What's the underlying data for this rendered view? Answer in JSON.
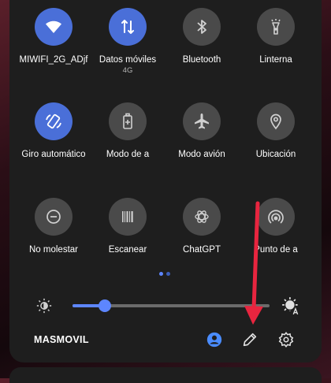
{
  "tiles": [
    {
      "label": "MIWIFI_2G_ADjf",
      "sub": "",
      "icon": "wifi-icon",
      "state": "on"
    },
    {
      "label": "Datos móviles",
      "sub": "4G",
      "icon": "mobile-data-icon",
      "state": "on"
    },
    {
      "label": "Bluetooth",
      "sub": "",
      "icon": "bluetooth-icon",
      "state": "off"
    },
    {
      "label": "Linterna",
      "sub": "",
      "icon": "flashlight-icon",
      "state": "off"
    },
    {
      "label": "Giro automático",
      "sub": "",
      "icon": "auto-rotate-icon",
      "state": "on"
    },
    {
      "label": "Modo de a",
      "sub": "",
      "icon": "battery-saver-icon",
      "state": "off"
    },
    {
      "label": "Modo avión",
      "sub": "",
      "icon": "airplane-icon",
      "state": "off"
    },
    {
      "label": "Ubicación",
      "sub": "",
      "icon": "location-icon",
      "state": "off"
    },
    {
      "label": "No molestar",
      "sub": "",
      "icon": "do-not-disturb-icon",
      "state": "off"
    },
    {
      "label": "Escanear",
      "sub": "",
      "icon": "scan-icon",
      "state": "off"
    },
    {
      "label": "ChatGPT",
      "sub": "",
      "icon": "chatgpt-icon",
      "state": "off"
    },
    {
      "label": "Punto de a",
      "sub": "",
      "icon": "hotspot-icon",
      "state": "off"
    }
  ],
  "page_indicator": {
    "pages": 2,
    "current": 1
  },
  "brightness": {
    "level": 0.14
  },
  "footer": {
    "carrier": "MASMOVIL"
  },
  "colors": {
    "accent": "#5d86ff",
    "tile_on": "#4a6fd8",
    "tile_off": "#4a4a4a",
    "annotation_arrow": "#e8253f"
  }
}
